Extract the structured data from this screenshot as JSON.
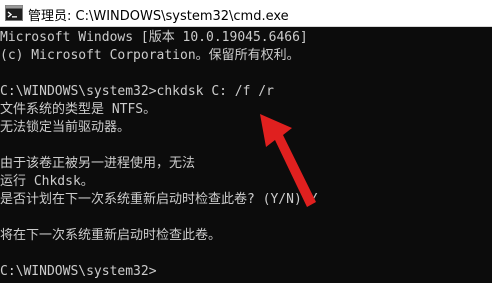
{
  "window": {
    "title": "管理员: C:\\WINDOWS\\system32\\cmd.exe",
    "icon": "cmd-icon"
  },
  "console": {
    "lines": [
      "Microsoft Windows [版本 10.0.19045.6466]",
      "(c) Microsoft Corporation。保留所有权利。",
      "",
      "C:\\WINDOWS\\system32>chkdsk C: /f /r",
      "文件系统的类型是 NTFS。",
      "无法锁定当前驱动器。",
      "",
      "由于该卷正被另一进程使用，无法",
      "运行 Chkdsk。",
      "是否计划在下一次系统重新启动时检查此卷? (Y/N) Y",
      "",
      "将在下一次系统重新启动时检查此卷。",
      "",
      "C:\\WINDOWS\\system32>"
    ]
  },
  "colors": {
    "console_bg": "#0c0c0c",
    "console_text": "#cccccc",
    "arrow": "#e0201f"
  },
  "annotation": {
    "icon": "red-arrow-icon"
  }
}
